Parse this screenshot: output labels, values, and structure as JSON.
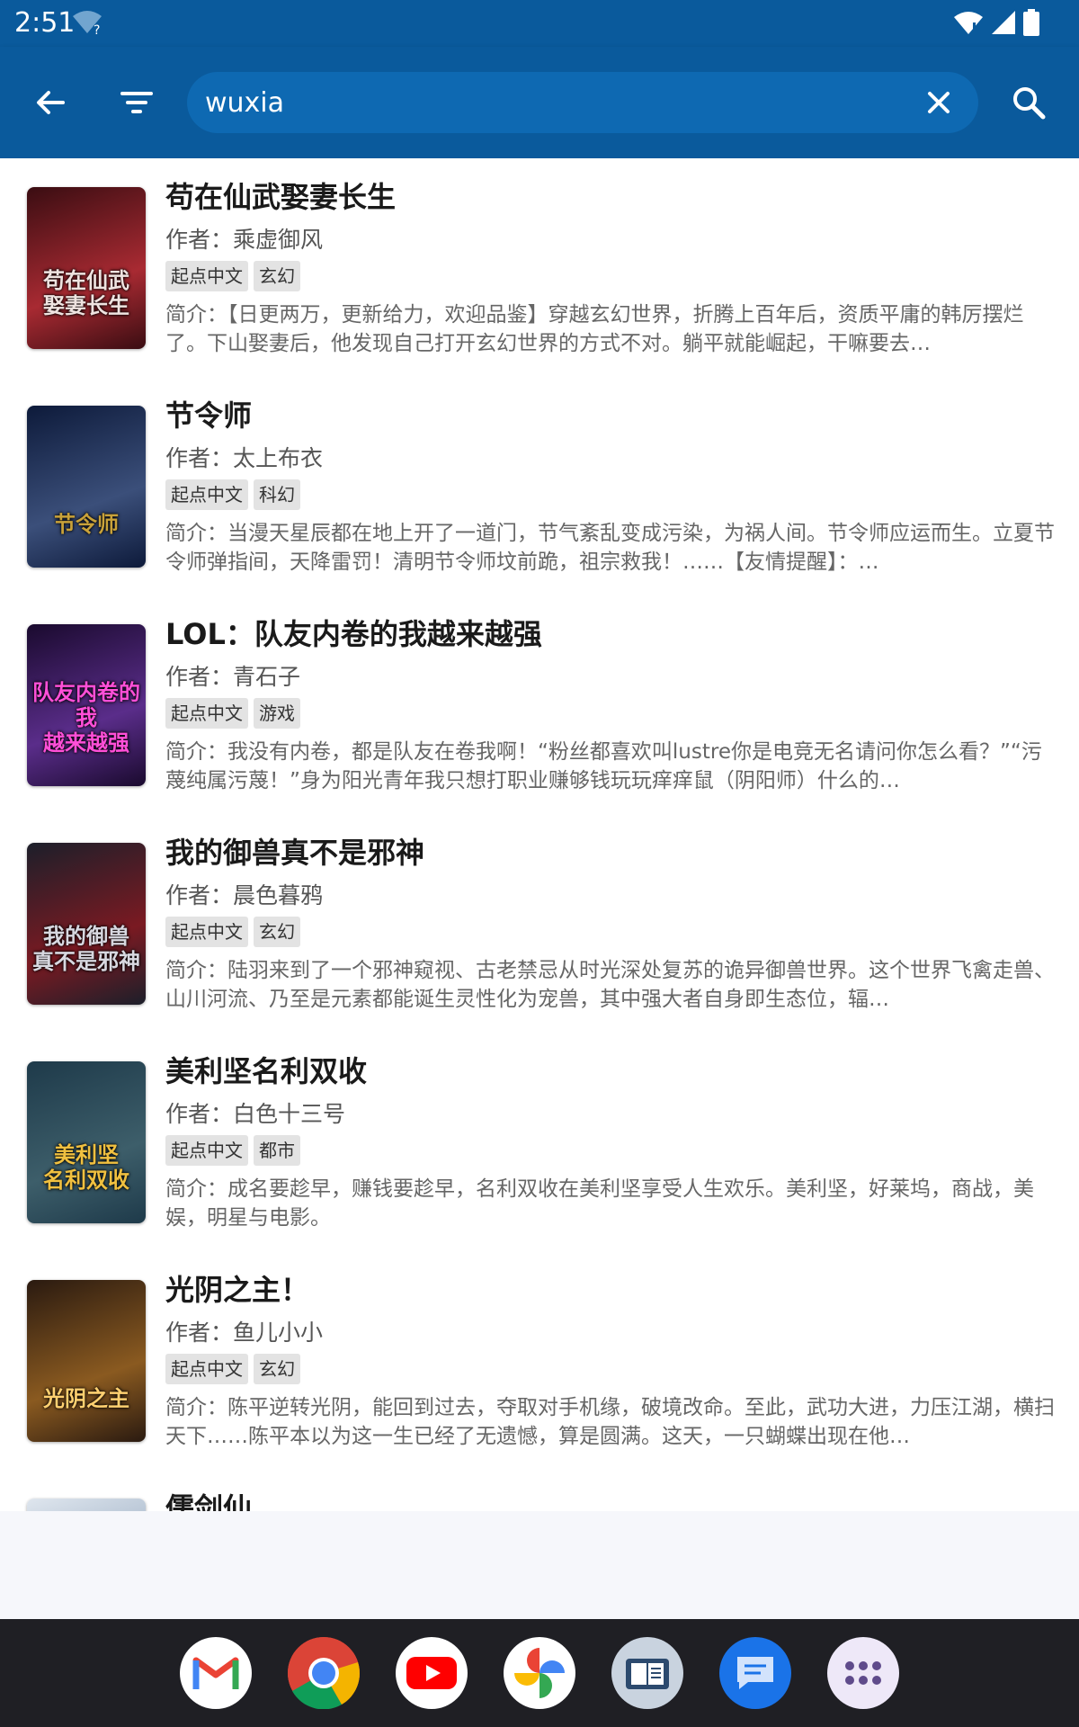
{
  "status_bar": {
    "time": "2:51"
  },
  "app_bar": {
    "search_value": "wuxia",
    "search_placeholder": ""
  },
  "books": [
    {
      "title": "苟在仙武娶妻长生",
      "author": "作者：乘虚御风",
      "tags": [
        "起点中文",
        "玄幻"
      ],
      "intro": "简介：【日更两万，更新给力，欢迎品鉴】穿越玄幻世界，折腾上百年后，资质平庸的韩厉摆烂了。下山娶妻后，他发现自己打开玄幻世界的方式不对。躺平就能崛起，干嘛要去…",
      "cover_text": "苟在仙武\n娶妻长生",
      "cover_colors": [
        "#3a0d12",
        "#a82a32",
        "#efe3e0"
      ]
    },
    {
      "title": "节令师",
      "author": "作者：太上布衣",
      "tags": [
        "起点中文",
        "科幻"
      ],
      "intro": "简介：当漫天星辰都在地上开了一道门，节气紊乱变成污染，为祸人间。节令师应运而生。立夏节令师弹指间，天降雷罚！清明节令师坟前跪，祖宗救我！……【友情提醒】：…",
      "cover_text": "节令师",
      "cover_colors": [
        "#0d1a3a",
        "#3b4f7a",
        "#c9a23a"
      ]
    },
    {
      "title": "LOL：队友内卷的我越来越强",
      "author": "作者：青石子",
      "tags": [
        "起点中文",
        "游戏"
      ],
      "intro": "简介：我没有内卷，都是队友在卷我啊！“粉丝都喜欢叫lustre你是电竞无名请问你怎么看？”“污蔑纯属污蔑！”身为阳光青年我只想打职业赚够钱玩玩痒痒鼠（阴阳师）什么的…",
      "cover_text": "队友内卷的我\n越来越强",
      "cover_colors": [
        "#1a0a2e",
        "#5a2d8a",
        "#ff4fd8"
      ]
    },
    {
      "title": "我的御兽真不是邪神",
      "author": "作者：晨色暮鸦",
      "tags": [
        "起点中文",
        "玄幻"
      ],
      "intro": "简介：陆羽来到了一个邪神窥视、古老禁忌从时光深处复苏的诡异御兽世界。这个世界飞禽走兽、山川河流、乃至是元素都能诞生灵性化为宠兽，其中强大者自身即生态位，辐…",
      "cover_text": "我的御兽\n真不是邪神",
      "cover_colors": [
        "#1c1f2a",
        "#7a1a22",
        "#d8d8e0"
      ]
    },
    {
      "title": "美利坚名利双收",
      "author": "作者：白色十三号",
      "tags": [
        "起点中文",
        "都市"
      ],
      "intro": "简介：成名要趁早，赚钱要趁早，名利双收在美利坚享受人生欢乐。美利坚，好莱坞，商战，美娱，明星与电影。",
      "cover_text": "美利坚\n名利双收",
      "cover_colors": [
        "#1e3a4a",
        "#3d5e6a",
        "#f0c040"
      ]
    },
    {
      "title": "光阴之主！",
      "author": "作者：鱼儿小小",
      "tags": [
        "起点中文",
        "玄幻"
      ],
      "intro": "简介：陈平逆转光阴，能回到过去，夺取对手机缘，破境改命。至此，武功大进，力压江湖，横扫天下……陈平本以为这一生已经了无遗憾，算是圆满。这天，一只蝴蝶出现在他…",
      "cover_text": "光阴之主",
      "cover_colors": [
        "#2a1a10",
        "#8a5a20",
        "#ffd070"
      ]
    },
    {
      "title": "儒剑仙",
      "author": "",
      "tags": [],
      "intro": "",
      "cover_text": "",
      "cover_colors": [
        "#dfe6ee",
        "#8fa4bc",
        "#ffffff"
      ]
    }
  ],
  "dock": {
    "apps": [
      "gmail-icon",
      "chrome-icon",
      "youtube-icon",
      "photos-icon",
      "reader-icon",
      "messages-icon",
      "app-drawer-icon"
    ]
  }
}
